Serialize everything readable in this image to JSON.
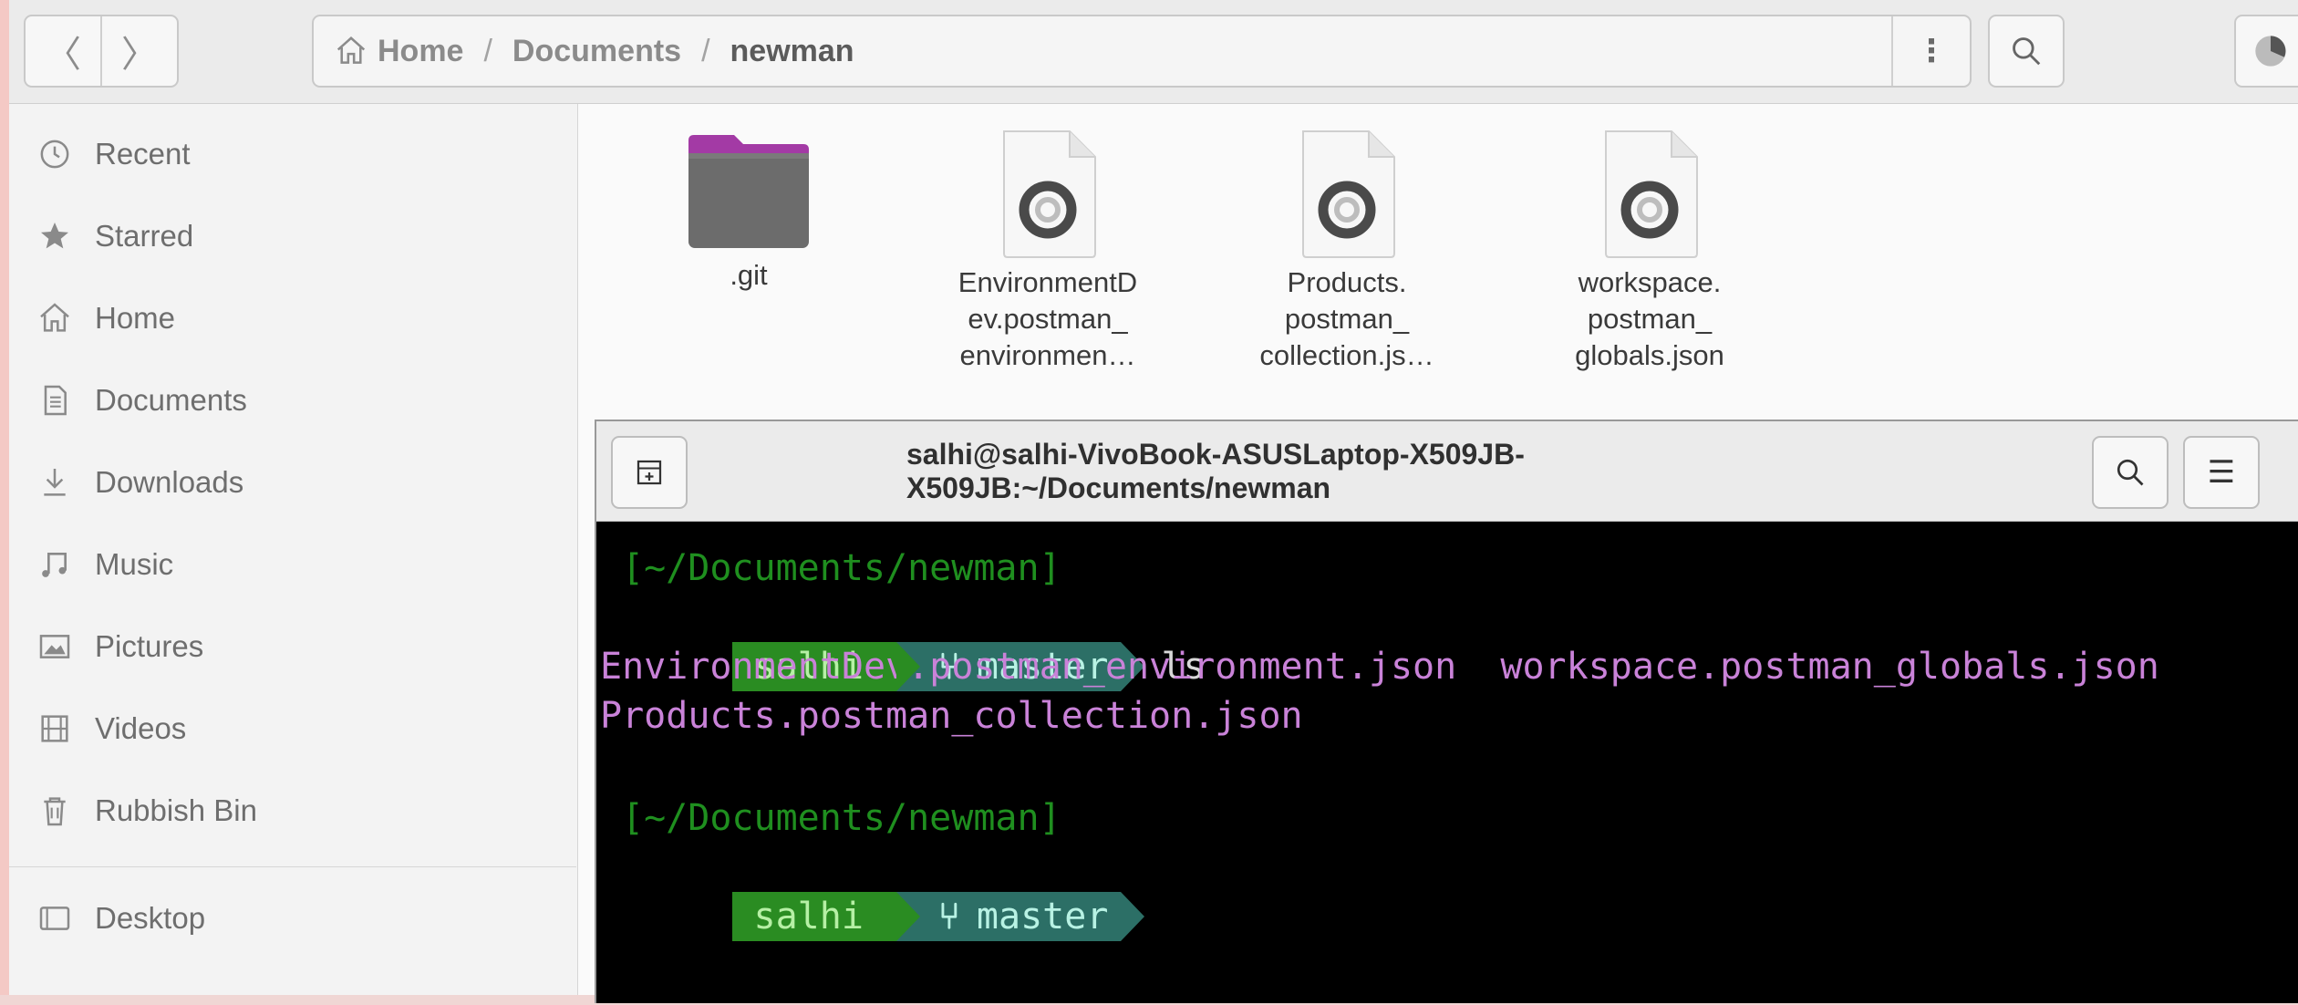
{
  "files": {
    "nav": {
      "back_icon": "chevron-left",
      "forward_icon": "chevron-right"
    },
    "path": [
      "Home",
      "Documents",
      "newman"
    ],
    "path_separator": "/",
    "path_menu_icon": "vertical-ellipsis",
    "sidebar": {
      "items": [
        {
          "label": "Recent",
          "icon": "clock-icon"
        },
        {
          "label": "Starred",
          "icon": "star-icon"
        },
        {
          "label": "Home",
          "icon": "home-icon"
        },
        {
          "label": "Documents",
          "icon": "document-icon"
        },
        {
          "label": "Downloads",
          "icon": "download-icon"
        },
        {
          "label": "Music",
          "icon": "music-icon"
        },
        {
          "label": "Pictures",
          "icon": "picture-icon"
        },
        {
          "label": "Videos",
          "icon": "film-icon"
        },
        {
          "label": "Rubbish Bin",
          "icon": "trash-icon"
        },
        {
          "label": "Desktop",
          "icon": "desktop-icon"
        }
      ]
    },
    "grid": [
      {
        "lines": [
          ".git"
        ],
        "type": "folder"
      },
      {
        "lines": [
          "EnvironmentD",
          "ev.postman_",
          "environmen…"
        ],
        "type": "json"
      },
      {
        "lines": [
          "Products.",
          "postman_",
          "collection.js…"
        ],
        "type": "json"
      },
      {
        "lines": [
          "workspace.",
          "postman_",
          "globals.json"
        ],
        "type": "json"
      }
    ],
    "accent_folder": "#a33aa5"
  },
  "terminal": {
    "title": "salhi@salhi-VivoBook-ASUSLaptop-X509JB-X509JB:~/Documents/newman",
    "cwd": "[~/Documents/newman]",
    "user": "salhi",
    "branch": "master",
    "command": "ls",
    "output": [
      "EnvironmentDev.postman_environment.json  workspace.postman_globals.json",
      "Products.postman_collection.json"
    ],
    "colors": {
      "user_bg": "#2a8c22",
      "branch_bg": "#2c6f66",
      "output": "#c982d8",
      "cwd": "#1f8f1f"
    }
  }
}
